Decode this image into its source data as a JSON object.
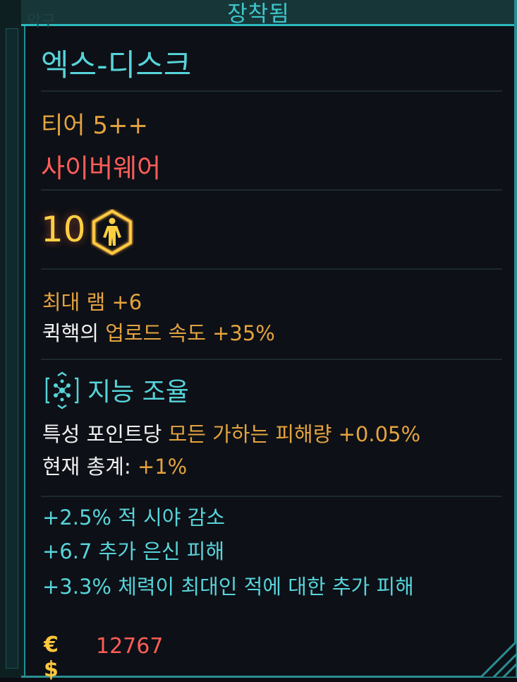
{
  "header": {
    "title": "장착됨",
    "ghost_text": "악구"
  },
  "item": {
    "name": "엑스-디스크",
    "tier": "티어 5++",
    "category": "사이버웨어",
    "requirement": {
      "value": "10",
      "icon": "body-attribute-icon"
    }
  },
  "stats": [
    {
      "parts": [
        {
          "text": "최대 램 +6",
          "color": "orange"
        }
      ]
    },
    {
      "parts": [
        {
          "text": "퀵핵의 ",
          "color": "white"
        },
        {
          "text": "업로드 속도 +35%",
          "color": "orange"
        }
      ]
    }
  ],
  "perk": {
    "icon": "intelligence-skill-icon",
    "title": "지능 조율",
    "lines": [
      {
        "parts": [
          {
            "text": "특성 포인트당 ",
            "color": "white"
          },
          {
            "text": "모든 가하는 피해량 +0.05%",
            "color": "orange"
          }
        ]
      },
      {
        "parts": [
          {
            "text": "현재 총계: ",
            "color": "white"
          },
          {
            "text": "+1%",
            "color": "orange"
          }
        ]
      }
    ]
  },
  "bonuses": [
    "+2.5%  적 시야 감소",
    "+6.7  추가 은신 피해",
    "+3.3%  체력이 최대인 적에 대한 추가 피해"
  ],
  "price": {
    "icon": "eurodollar-icon",
    "symbol": "€$",
    "value": "12767"
  },
  "colors": {
    "accent": "#56d4da",
    "orange": "#e4a33f",
    "red": "#ff5d57",
    "gold": "#ffcf42"
  }
}
